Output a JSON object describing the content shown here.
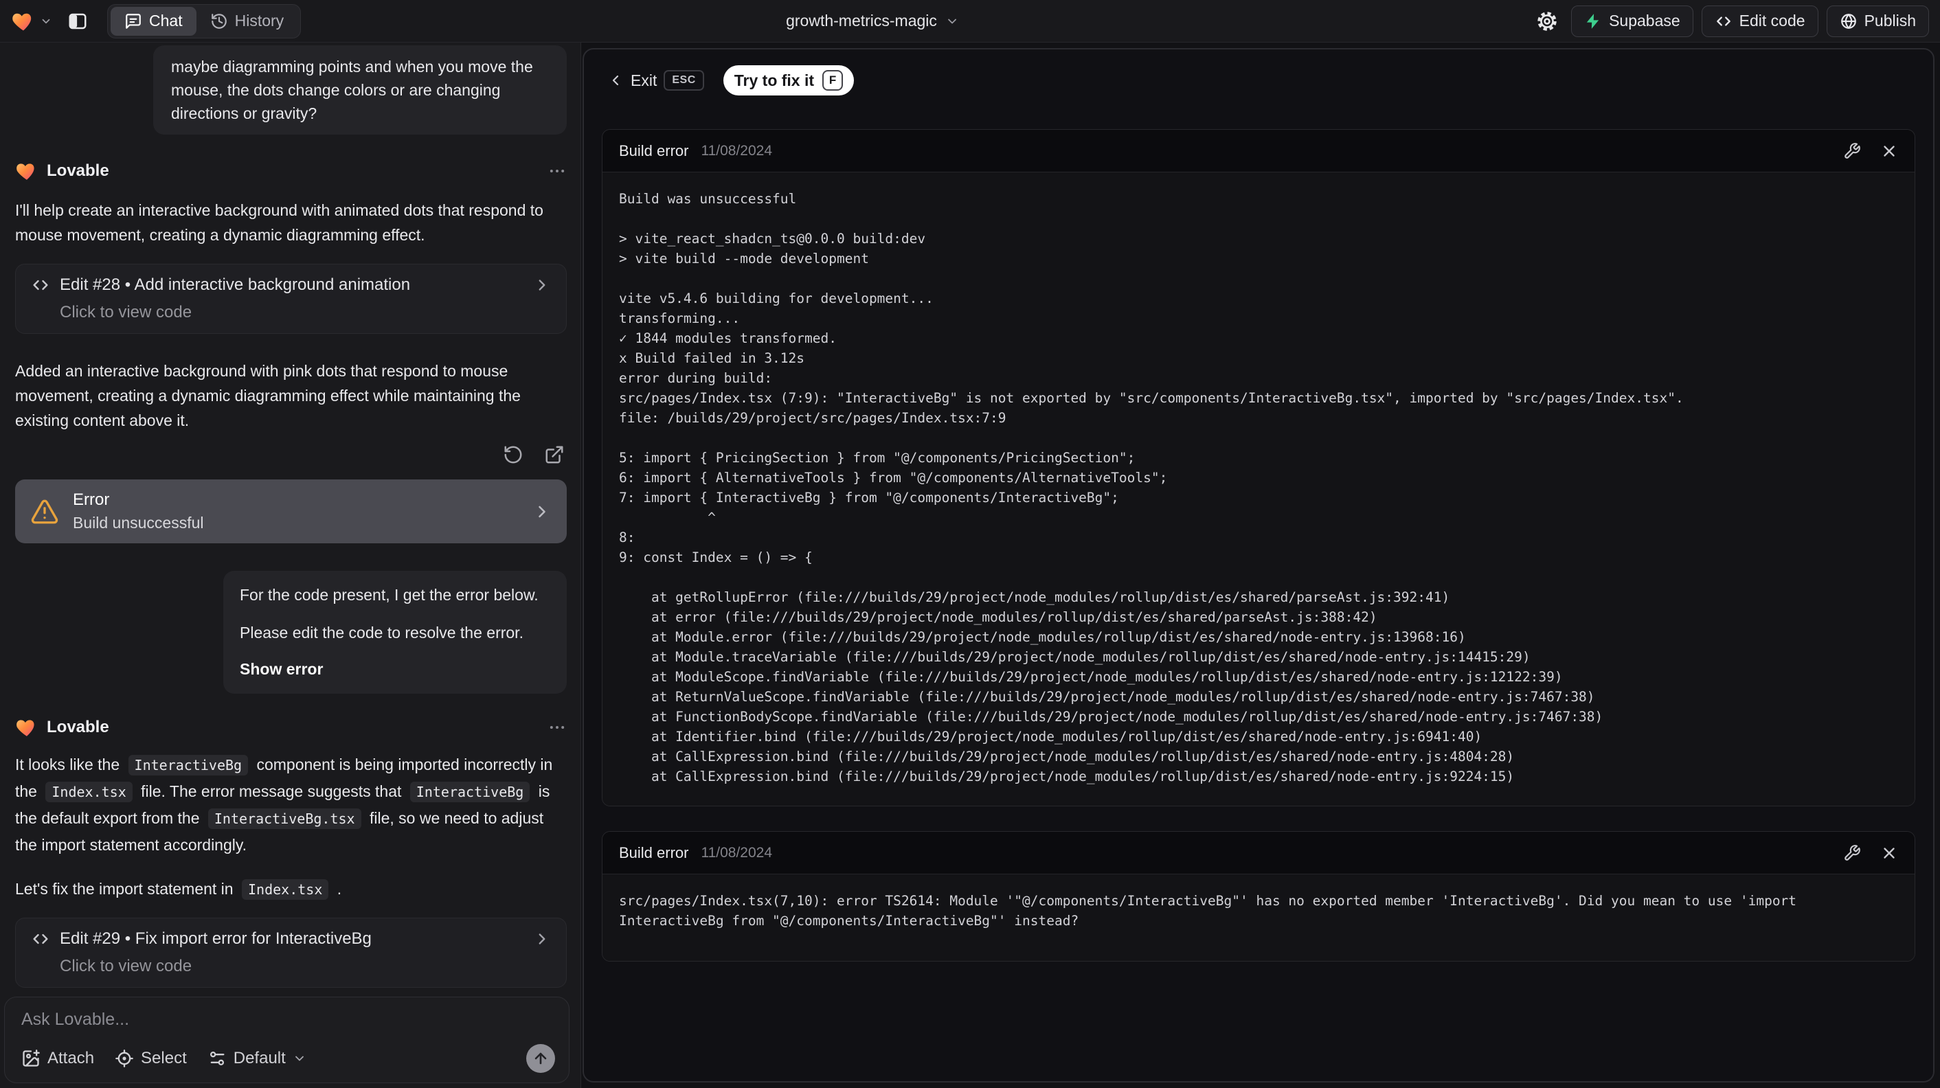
{
  "topbar": {
    "app_name": "Lovable",
    "project_name": "growth-metrics-magic",
    "tabs": {
      "chat": "Chat",
      "history": "History"
    },
    "buttons": {
      "supabase": "Supabase",
      "edit_code": "Edit code",
      "publish": "Publish"
    },
    "icons": [
      "lovable-heart-icon",
      "chevron-down-icon",
      "panel-left-icon",
      "chat-bubble-icon",
      "history-clock-icon",
      "gear-icon",
      "supabase-bolt-icon",
      "code-icon",
      "globe-icon"
    ]
  },
  "chat": {
    "user_message_1": "maybe diagramming points and when you move the mouse, the dots change colors or are changing directions or gravity?",
    "assistant_name": "Lovable",
    "assistant_1": {
      "intro": "I'll help create an interactive background with animated dots that respond to mouse movement, creating a dynamic diagramming effect.",
      "edit_card": {
        "title": "Edit #28 • Add interactive background animation",
        "subtitle": "Click to view code"
      },
      "summary": "Added an interactive background with pink dots that respond to mouse movement, creating a dynamic diagramming effect while maintaining the existing content above it."
    },
    "error_card": {
      "title": "Error",
      "subtitle": "Build unsuccessful"
    },
    "user_message_2": {
      "line1": "For the code present, I get the error below.",
      "line2": "Please edit the code to resolve the error.",
      "action": "Show error"
    },
    "assistant_2": {
      "intro_rich": [
        {
          "t": "It looks like the "
        },
        {
          "c": "InteractiveBg"
        },
        {
          "t": " component is being imported incorrectly in the "
        },
        {
          "c": "Index.tsx"
        },
        {
          "t": " file. The error message suggests that "
        },
        {
          "c": "InteractiveBg"
        },
        {
          "t": " is the default export from the "
        },
        {
          "c": "InteractiveBg.tsx"
        },
        {
          "t": " file, so we need to adjust the import statement accordingly."
        }
      ],
      "fix_rich": [
        {
          "t": "Let's fix the import statement in "
        },
        {
          "c": "Index.tsx"
        },
        {
          "t": " ."
        }
      ],
      "edit_card": {
        "title": "Edit #29 • Fix import error for InteractiveBg",
        "subtitle": "Click to view code"
      }
    },
    "input": {
      "placeholder": "Ask Lovable...",
      "attach": "Attach",
      "select": "Select",
      "mode": "Default"
    },
    "icons": [
      "more-horizontal-icon",
      "code-icon",
      "chevron-right-icon",
      "refresh-icon",
      "open-external-icon",
      "warning-triangle-icon",
      "image-plus-icon",
      "target-select-icon",
      "sliders-icon",
      "chevron-down-icon",
      "arrow-up-icon"
    ]
  },
  "preview": {
    "exit_label": "Exit",
    "exit_key": "ESC",
    "fix_label": "Try to fix it",
    "fix_key": "F",
    "icons": [
      "chevron-left-icon",
      "wrench-icon",
      "close-icon"
    ],
    "panels": [
      {
        "title": "Build error",
        "date": "11/08/2024",
        "log": [
          "Build was unsuccessful",
          "",
          "> vite_react_shadcn_ts@0.0.0 build:dev",
          "> vite build --mode development",
          "",
          "vite v5.4.6 building for development...",
          "transforming...",
          "✓ 1844 modules transformed.",
          "x Build failed in 3.12s",
          "error during build:",
          "src/pages/Index.tsx (7:9): \"InteractiveBg\" is not exported by \"src/components/InteractiveBg.tsx\", imported by \"src/pages/Index.tsx\".",
          "file: /builds/29/project/src/pages/Index.tsx:7:9",
          "",
          "5: import { PricingSection } from \"@/components/PricingSection\";",
          "6: import { AlternativeTools } from \"@/components/AlternativeTools\";",
          "7: import { InteractiveBg } from \"@/components/InteractiveBg\";",
          "           ^",
          "8:",
          "9: const Index = () => {",
          "",
          "    at getRollupError (file:///builds/29/project/node_modules/rollup/dist/es/shared/parseAst.js:392:41)",
          "    at error (file:///builds/29/project/node_modules/rollup/dist/es/shared/parseAst.js:388:42)",
          "    at Module.error (file:///builds/29/project/node_modules/rollup/dist/es/shared/node-entry.js:13968:16)",
          "    at Module.traceVariable (file:///builds/29/project/node_modules/rollup/dist/es/shared/node-entry.js:14415:29)",
          "    at ModuleScope.findVariable (file:///builds/29/project/node_modules/rollup/dist/es/shared/node-entry.js:12122:39)",
          "    at ReturnValueScope.findVariable (file:///builds/29/project/node_modules/rollup/dist/es/shared/node-entry.js:7467:38)",
          "    at FunctionBodyScope.findVariable (file:///builds/29/project/node_modules/rollup/dist/es/shared/node-entry.js:7467:38)",
          "    at Identifier.bind (file:///builds/29/project/node_modules/rollup/dist/es/shared/node-entry.js:6941:40)",
          "    at CallExpression.bind (file:///builds/29/project/node_modules/rollup/dist/es/shared/node-entry.js:4804:28)",
          "    at CallExpression.bind (file:///builds/29/project/node_modules/rollup/dist/es/shared/node-entry.js:9224:15)"
        ]
      },
      {
        "title": "Build error",
        "date": "11/08/2024",
        "log": [
          "src/pages/Index.tsx(7,10): error TS2614: Module '\"@/components/InteractiveBg\"' has no exported member 'InteractiveBg'. Did you mean to use 'import",
          "InteractiveBg from \"@/components/InteractiveBg\"' instead?"
        ]
      }
    ]
  },
  "colors": {
    "supabase_green": "#3ecf8e",
    "warning_amber": "#e8a33d",
    "fix_button_bg": "#ffffff",
    "error_card_bg": "#4a4a51",
    "chat_bg": "#1a1a1d",
    "panel_bg": "#131316"
  }
}
